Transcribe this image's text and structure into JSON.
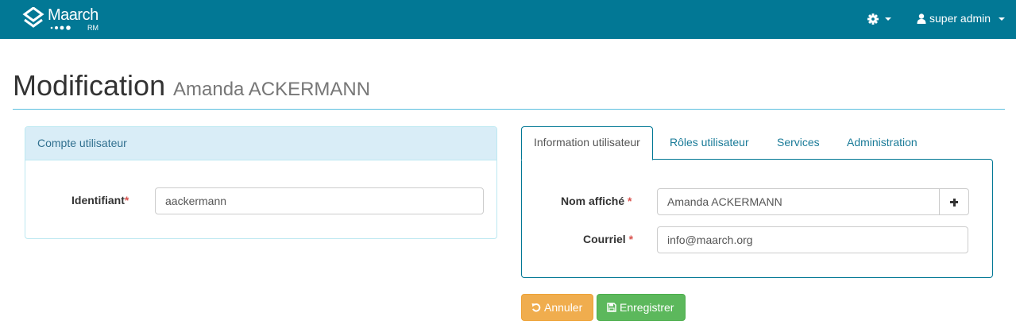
{
  "navbar": {
    "logo_text": "Maarch",
    "logo_sub": "RM",
    "settings_icon": "gear-icon",
    "user_icon": "user-icon",
    "user_label": "super admin",
    "background": "#027895"
  },
  "page": {
    "title": "Modification",
    "subtitle": "Amanda ACKERMANN"
  },
  "account_panel": {
    "heading": "Compte utilisateur",
    "identifier_label": "Identifiant",
    "identifier_required": "*",
    "identifier_value": "aackermann"
  },
  "tabs": [
    {
      "label": "Information utilisateur",
      "active": true
    },
    {
      "label": "Rôles utilisateur",
      "active": false
    },
    {
      "label": "Services",
      "active": false
    },
    {
      "label": "Administration",
      "active": false
    }
  ],
  "user_info": {
    "display_name_label": "Nom affiché",
    "display_name_required": "*",
    "display_name_value": "Amanda ACKERMANN",
    "add_icon": "plus-icon",
    "email_label": "Courriel",
    "email_required": "*",
    "email_value": "info@maarch.org"
  },
  "actions": {
    "cancel_label": "Annuler",
    "cancel_icon": "undo-icon",
    "save_label": "Enregistrer",
    "save_icon": "floppy-disk-icon",
    "cancel_color": "#f0ad4e",
    "save_color": "#5cb85c"
  }
}
